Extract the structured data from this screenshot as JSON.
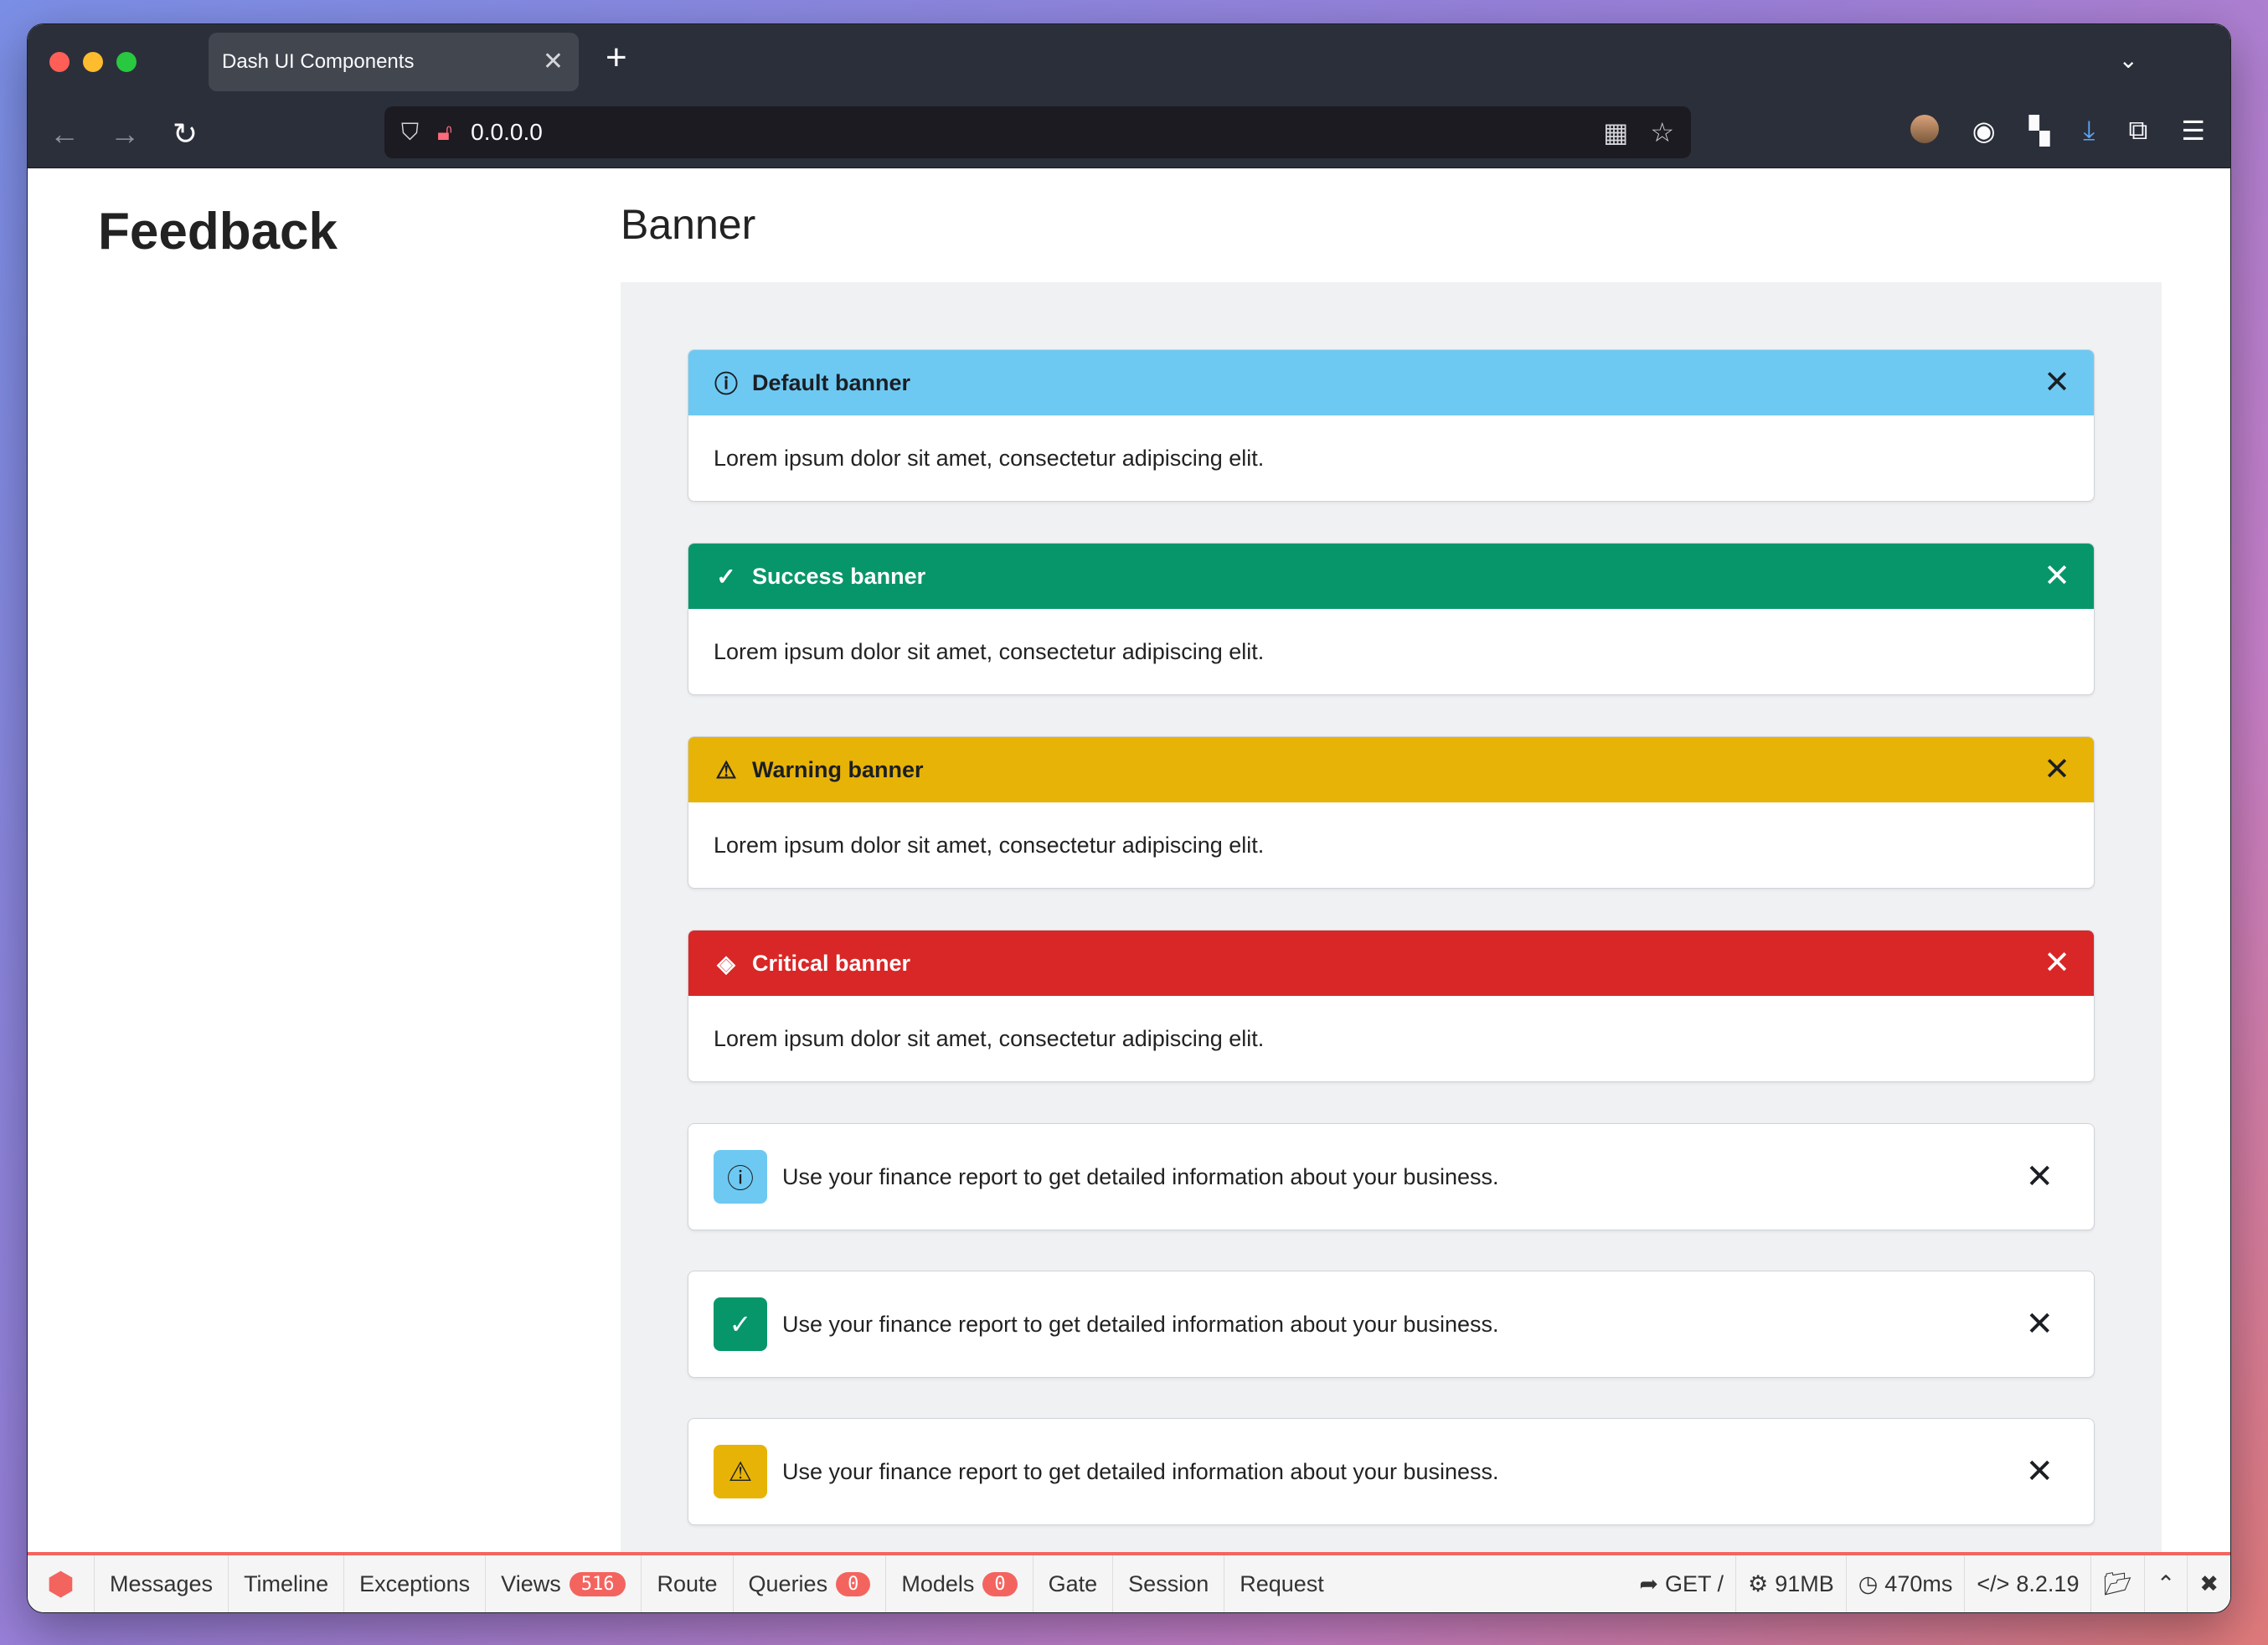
{
  "browser": {
    "tab_title": "Dash UI Components",
    "url": "0.0.0.0"
  },
  "sidebar": {
    "title": "Feedback"
  },
  "main": {
    "title": "Banner",
    "banners": [
      {
        "title": "Default banner",
        "body": "Lorem ipsum dolor sit amet, consectetur adipiscing elit.",
        "icon": "info-icon",
        "color": "#6ec9f2"
      },
      {
        "title": "Success banner",
        "body": "Lorem ipsum dolor sit amet, consectetur adipiscing elit.",
        "icon": "check-icon",
        "color": "#07966a"
      },
      {
        "title": "Warning banner",
        "body": "Lorem ipsum dolor sit amet, consectetur adipiscing elit.",
        "icon": "warning-icon",
        "color": "#e8b307"
      },
      {
        "title": "Critical banner",
        "body": "Lorem ipsum dolor sit amet, consectetur adipiscing elit.",
        "icon": "critical-icon",
        "color": "#d92626"
      }
    ],
    "notes": [
      {
        "text": "Use your finance report to get detailed information about your business.",
        "icon": "info-icon",
        "color": "#6ec9f2"
      },
      {
        "text": "Use your finance report to get detailed information about your business.",
        "icon": "check-icon",
        "color": "#07966a"
      },
      {
        "text": "Use your finance report to get detailed information about your business.",
        "icon": "warning-icon",
        "color": "#e8b307"
      }
    ]
  },
  "debugbar": {
    "items": [
      "Messages",
      "Timeline",
      "Exceptions",
      "Views",
      "Route",
      "Queries",
      "Models",
      "Gate",
      "Session",
      "Request"
    ],
    "views_count": "516",
    "queries_count": "0",
    "models_count": "0",
    "method": "GET /",
    "memory": "91MB",
    "time": "470ms",
    "php_version": "8.2.19",
    "accent_color": "#f4645f"
  }
}
